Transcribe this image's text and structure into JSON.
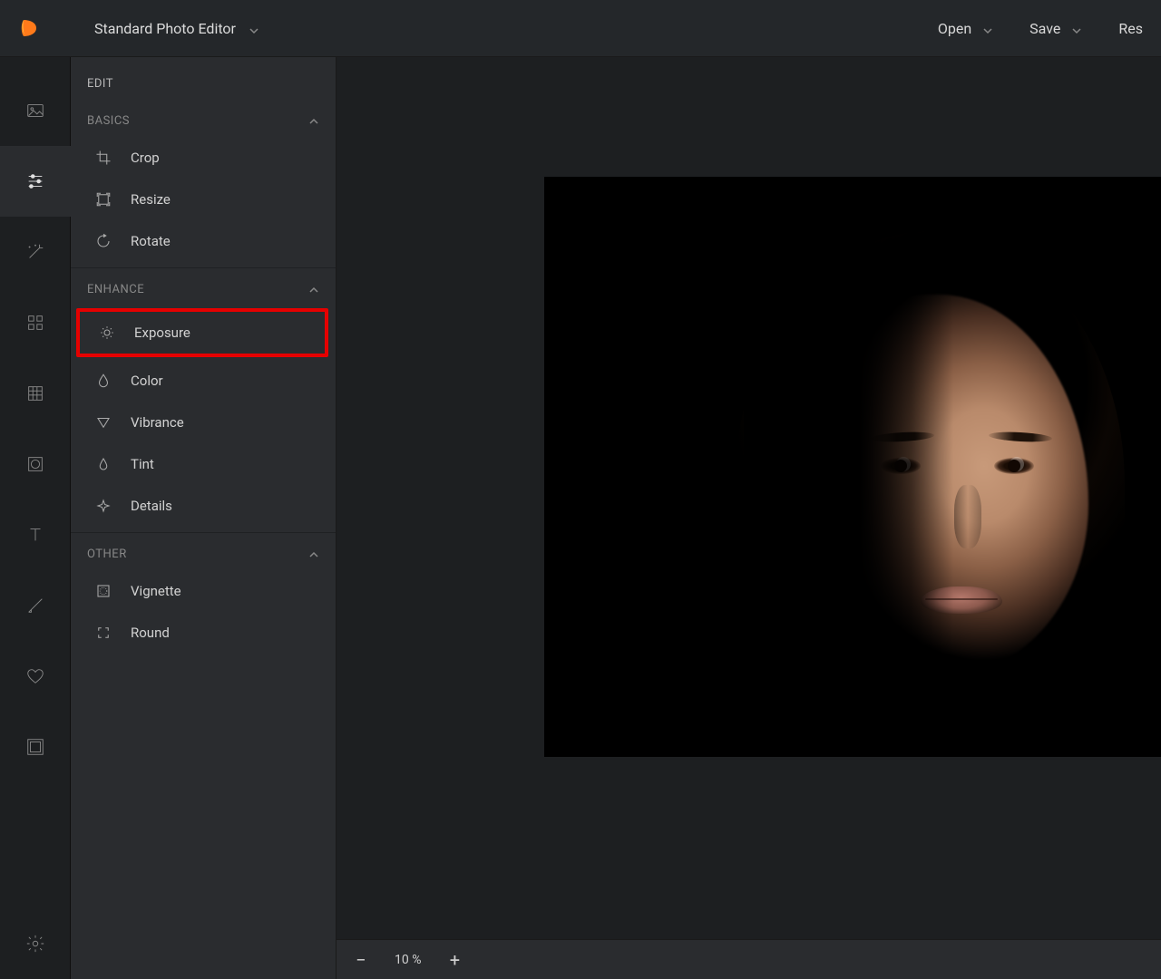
{
  "header": {
    "editor_mode": "Standard Photo Editor",
    "open_label": "Open",
    "save_label": "Save",
    "reset_label": "Res"
  },
  "panel": {
    "title": "EDIT",
    "sections": {
      "basics": {
        "label": "BASICS",
        "items": {
          "crop": "Crop",
          "resize": "Resize",
          "rotate": "Rotate"
        }
      },
      "enhance": {
        "label": "ENHANCE",
        "items": {
          "exposure": "Exposure",
          "color": "Color",
          "vibrance": "Vibrance",
          "tint": "Tint",
          "details": "Details"
        }
      },
      "other": {
        "label": "OTHER",
        "items": {
          "vignette": "Vignette",
          "round": "Round"
        }
      }
    }
  },
  "zoom": {
    "value": "10 %"
  }
}
